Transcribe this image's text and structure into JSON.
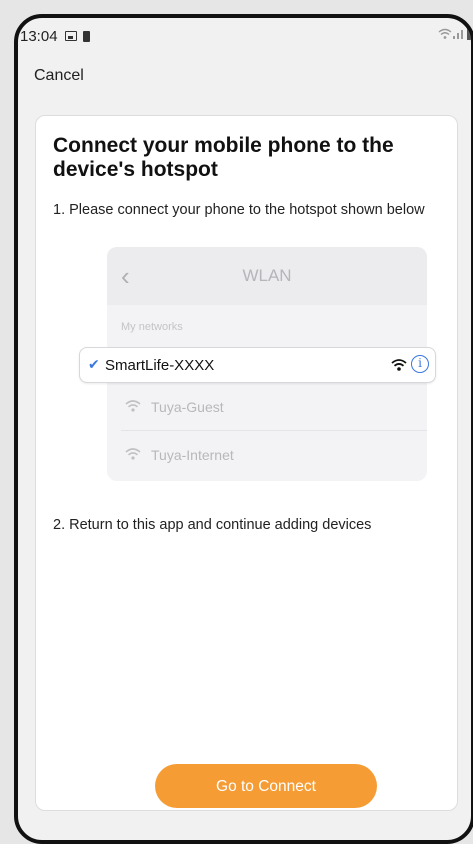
{
  "status_bar": {
    "time": "13:04",
    "icons": [
      "image-icon",
      "battery-icon",
      "wifi-signal-icon",
      "cell-signal-icon"
    ]
  },
  "nav": {
    "cancel_label": "Cancel"
  },
  "card": {
    "title": "Connect your mobile phone to the device's hotspot",
    "step1": "1. Please connect your phone to the hotspot shown below",
    "step2": "2. Return to this app and continue adding devices"
  },
  "wlan": {
    "title": "WLAN",
    "section_label": "My networks",
    "selected_network": "SmartLife-XXXX",
    "other_networks": [
      "Tuya-Guest",
      "Tuya-Internet"
    ]
  },
  "actions": {
    "connect_label": "Go to Connect"
  },
  "colors": {
    "accent": "#f59c35",
    "link_blue": "#3a78e0"
  }
}
